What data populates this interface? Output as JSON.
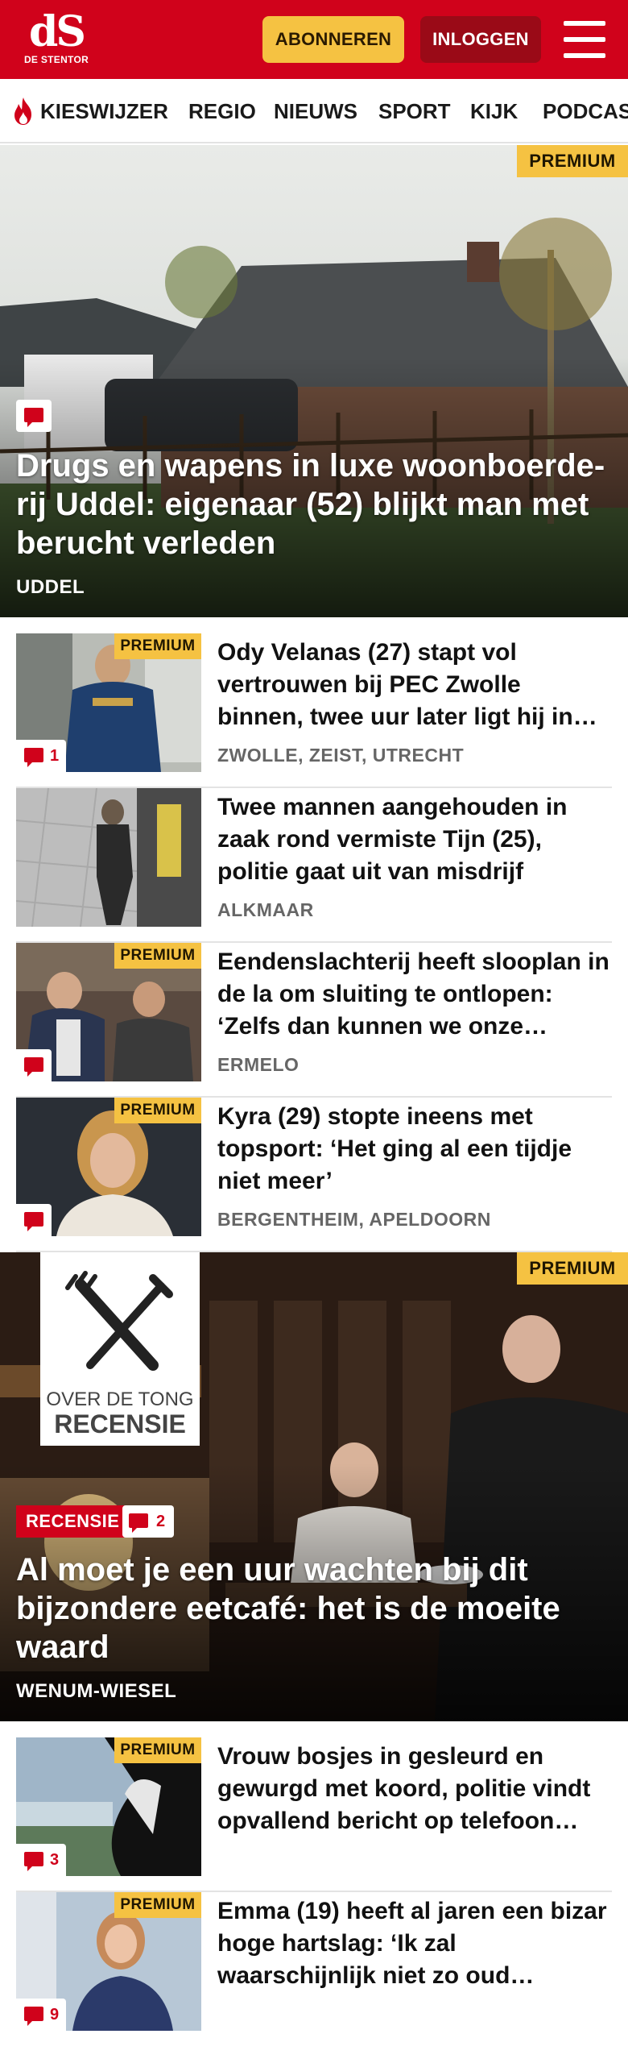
{
  "header": {
    "logo_mark": "dS",
    "logo_sub": "DE STENTOR",
    "subscribe_label": "ABONNEREN",
    "login_label": "INLOGGEN",
    "brand_color": "#d0021b",
    "accent_color": "#f5c242"
  },
  "nav": {
    "items": [
      {
        "label": "KIESWIJZER",
        "icon": "flame-icon"
      },
      {
        "label": "REGIO"
      },
      {
        "label": "NIEUWS"
      },
      {
        "label": "SPORT"
      },
      {
        "label": "KIJK"
      },
      {
        "label": "PODCAS"
      }
    ]
  },
  "lead": {
    "premium": "PREMIUM",
    "title": "Drugs en wapens in luxe woonboerde­rij Uddel: eigenaar (52) blijkt man met berucht verleden",
    "location": "UDDEL",
    "icon": "comment-icon"
  },
  "articles": [
    {
      "premium": "PREMIUM",
      "title": "Ody Velanas (27) stapt vol vertrouwen bij PEC Zwolle binnen, twee uur later ligt hij in…",
      "location": "ZWOLLE, ZEIST, UTRECHT",
      "comments": "1"
    },
    {
      "title": "Twee mannen aangehouden in zaak rond vermiste Tijn (25), politie gaat uit van misdrijf",
      "location": "ALKMAAR"
    },
    {
      "premium": "PREMIUM",
      "title": "Eendenslachterij heeft slooplan in de la om sluiting te ontlopen: ‘Zelfs dan kunnen we onze…",
      "location": "ERMELO"
    },
    {
      "premium": "PREMIUM",
      "title": "Kyra (29) stopte ineens met topsport: ‘Het ging al een tijdje niet meer’",
      "location": "BERGENTHEIM, APELDOORN"
    }
  ],
  "review": {
    "premium": "PREMIUM",
    "logo_line1": "OVER DE TONG",
    "logo_line2": "RECENSIE",
    "label": "RECENSIE",
    "comments": "2",
    "title": "Al moet je een uur wachten bij dit bijzondere eetcafé: het is de moeite waard",
    "location": "WENUM-WIESEL"
  },
  "articles2": [
    {
      "premium": "PREMIUM",
      "title": "Vrouw bosjes in gesleurd en gewurgd met koord, politie vindt opvallend bericht op telefoon…",
      "comments": "3"
    },
    {
      "premium": "PREMIUM",
      "title": "Emma (19) heeft al jaren een bizar hoge hartslag: ‘Ik zal waarschijnlijk niet zo oud…",
      "comments": "9"
    }
  ]
}
